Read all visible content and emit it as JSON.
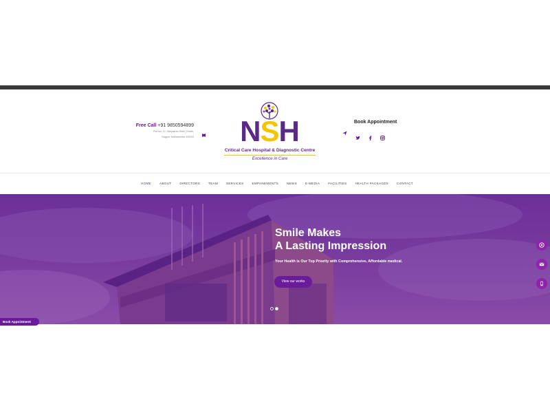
{
  "header": {
    "call_label": "Free Call",
    "phone": "+91 9850594899",
    "address_line1": "Plot No. 12, Ganpatrao Shah Chowk,",
    "address_line2": "Nagpur, Maharashtra 440003",
    "book_heading": "Book Appointment",
    "social_icons": [
      "twitter-icon",
      "facebook-icon",
      "instagram-icon"
    ]
  },
  "logo": {
    "letters": [
      "N",
      "S",
      "H"
    ],
    "subtitle": "Critical Care Hospital & Diagnostic Centre",
    "tagline": "Excellence in Care"
  },
  "nav": {
    "items": [
      "HOME",
      "ABOUT",
      "DIRECTORS",
      "TEAM",
      "SERVICES",
      "EMPANEMENTS",
      "NEWS",
      "E-MEDIA",
      "FACILITIES",
      "HEALTH PACKAGES",
      "CONTACT"
    ],
    "active": "HOME"
  },
  "hero": {
    "title_line1": "Smile Makes",
    "title_line2": "A Lasting Impression",
    "description": "Your Health is Our Top Priority with Comprehensive, Affordable medical.",
    "cta_label": "View our works",
    "slide_count": 2,
    "active_slide": 2
  },
  "floating": {
    "book_tab": "Book Appointment",
    "side_buttons": [
      "whatsapp-icon",
      "mail-icon",
      "phone-icon"
    ]
  },
  "colors": {
    "brand_purple": "#6a1b9a",
    "brand_yellow": "#f5c400"
  }
}
